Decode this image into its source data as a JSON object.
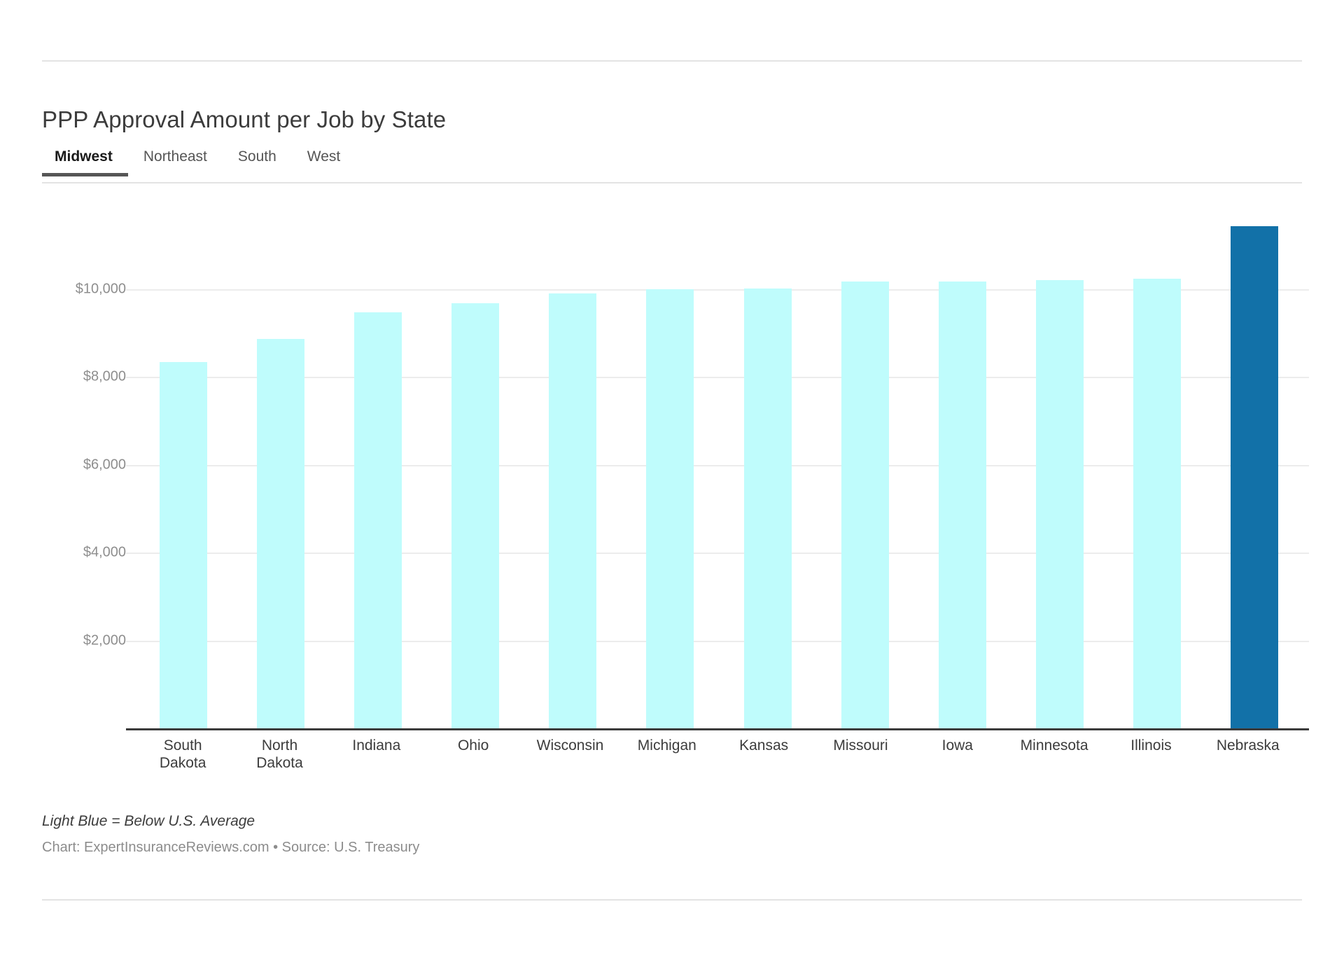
{
  "header": {
    "title": "PPP Approval Amount per Job by State"
  },
  "tabs": [
    {
      "label": "Midwest",
      "active": true
    },
    {
      "label": "Northeast",
      "active": false
    },
    {
      "label": "South",
      "active": false
    },
    {
      "label": "West",
      "active": false
    }
  ],
  "footer": {
    "note": "Light Blue = Below U.S. Average",
    "credit": "Chart: ExpertInsuranceReviews.com • Source: U.S. Treasury"
  },
  "colors": {
    "bar_default": "#bffcfc",
    "bar_highlight": "#1271a8",
    "gridline": "#ececec",
    "axis": "#3b3b3b",
    "tab_active_underline": "#565656"
  },
  "chart_data": {
    "type": "bar",
    "title": "PPP Approval Amount per Job by State",
    "xlabel": "",
    "ylabel": "",
    "ylim": [
      0,
      11800
    ],
    "grid": true,
    "legend": "none",
    "ytick_values": [
      2000,
      4000,
      6000,
      8000,
      10000
    ],
    "ytick_labels": [
      "$2,000",
      "$4,000",
      "$6,000",
      "$8,000",
      "$10,000"
    ],
    "categories": [
      "South Dakota",
      "North Dakota",
      "Indiana",
      "Ohio",
      "Wisconsin",
      "Michigan",
      "Kansas",
      "Missouri",
      "Iowa",
      "Minnesota",
      "Illinois",
      "Nebraska"
    ],
    "category_lines": [
      [
        "South",
        "Dakota"
      ],
      [
        "North",
        "Dakota"
      ],
      [
        "Indiana"
      ],
      [
        "Ohio"
      ],
      [
        "Wisconsin"
      ],
      [
        "Michigan"
      ],
      [
        "Kansas"
      ],
      [
        "Missouri"
      ],
      [
        "Iowa"
      ],
      [
        "Minnesota"
      ],
      [
        "Illinois"
      ],
      [
        "Nebraska"
      ]
    ],
    "values": [
      8340,
      8860,
      9480,
      9680,
      9900,
      10000,
      10010,
      10180,
      10180,
      10200,
      10240,
      11440
    ],
    "highlight_index": 11,
    "annotations": [
      "Light Blue = Below U.S. Average",
      "Chart: ExpertInsuranceReviews.com • Source: U.S. Treasury"
    ]
  }
}
